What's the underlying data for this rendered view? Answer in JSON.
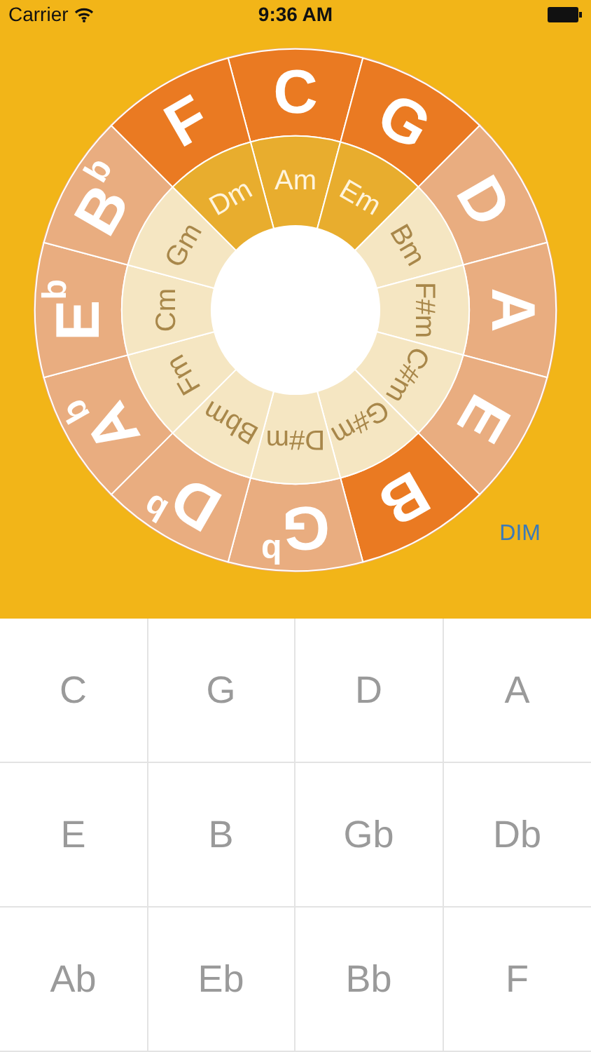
{
  "status_bar": {
    "carrier": "Carrier",
    "time": "9:36 AM"
  },
  "wheel": {
    "majors": [
      {
        "label": "C",
        "selected": true
      },
      {
        "label": "G",
        "selected": true
      },
      {
        "label": "D",
        "selected": false
      },
      {
        "label": "A",
        "selected": false
      },
      {
        "label": "E",
        "selected": false
      },
      {
        "label": "B",
        "selected": true
      },
      {
        "label": "G$^{b}$",
        "selected": false
      },
      {
        "label": "D$^{b}$",
        "selected": false
      },
      {
        "label": "A$^{b}$",
        "selected": false
      },
      {
        "label": "E$^{b}$",
        "selected": false
      },
      {
        "label": "B$^{b}$",
        "selected": false
      },
      {
        "label": "F",
        "selected": true
      }
    ],
    "minors": [
      {
        "label": "Am",
        "selected": true
      },
      {
        "label": "Em",
        "selected": true
      },
      {
        "label": "Bm",
        "selected": false
      },
      {
        "label": "F#m",
        "selected": false
      },
      {
        "label": "C#m",
        "selected": false
      },
      {
        "label": "G#m",
        "selected": false
      },
      {
        "label": "D#m",
        "selected": false
      },
      {
        "label": "Bbm",
        "selected": false
      },
      {
        "label": "Fm",
        "selected": false
      },
      {
        "label": "Cm",
        "selected": false
      },
      {
        "label": "Gm",
        "selected": false
      },
      {
        "label": "Dm",
        "selected": true
      }
    ]
  },
  "dim_button": "DIM",
  "keys": [
    "C",
    "G",
    "D",
    "A",
    "E",
    "B",
    "Gb",
    "Db",
    "Ab",
    "Eb",
    "Bb",
    "F"
  ]
}
